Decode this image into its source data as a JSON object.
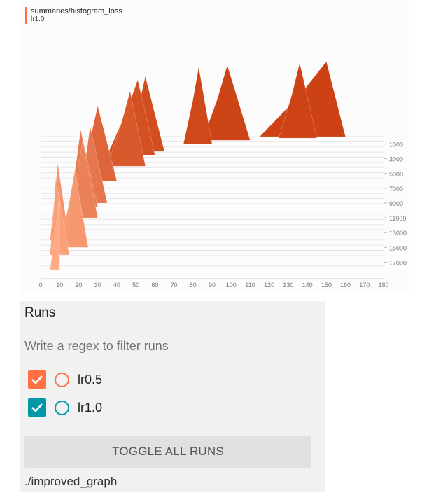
{
  "chart": {
    "tag": "summaries/histogram_loss",
    "run": "lr1.0",
    "y_tick_labels": [
      "1000",
      "3000",
      "5000",
      "7000",
      "9000",
      "11000",
      "13000",
      "15000",
      "17000"
    ],
    "x_tick_labels": [
      "0",
      "10",
      "20",
      "30",
      "40",
      "50",
      "60",
      "70",
      "80",
      "90",
      "100",
      "110",
      "120",
      "130",
      "140",
      "150",
      "160",
      "170",
      "180"
    ]
  },
  "chart_data": {
    "type": "area",
    "title": "summaries/histogram_loss",
    "run": "lr1.0",
    "mode": "offset",
    "xlim": [
      0,
      180
    ],
    "step_ticks": [
      1000,
      3000,
      5000,
      7000,
      9000,
      11000,
      13000,
      15000,
      17000
    ],
    "x_ticks": [
      0,
      10,
      20,
      30,
      40,
      50,
      60,
      70,
      80,
      90,
      100,
      110,
      120,
      130,
      140,
      150,
      160,
      170,
      180
    ],
    "slices_approx": [
      {
        "step": 18000,
        "x": [
          5,
          10
        ],
        "peak": 10
      },
      {
        "step": 16000,
        "x": [
          5,
          15
        ],
        "peak": 8
      },
      {
        "step": 15000,
        "x": [
          10,
          25
        ],
        "peak": 18
      },
      {
        "step": 14000,
        "x": [
          5,
          15
        ],
        "peak": 9
      },
      {
        "step": 11000,
        "x": [
          15,
          30
        ],
        "peak": 22
      },
      {
        "step": 9500,
        "x": [
          15,
          30
        ],
        "peak": 21
      },
      {
        "step": 9000,
        "x": [
          20,
          35
        ],
        "peak": 26
      },
      {
        "step": 6000,
        "x": [
          20,
          40
        ],
        "peak": 30
      },
      {
        "step": 4000,
        "x": [
          35,
          55
        ],
        "peak": 47
      },
      {
        "step": 2500,
        "x": [
          35,
          60
        ],
        "peak": 51
      },
      {
        "step": 2000,
        "x": [
          45,
          65
        ],
        "peak": 55
      },
      {
        "step": 1000,
        "x": [
          75,
          90
        ],
        "peak": 83
      },
      {
        "step": 500,
        "x": [
          85,
          110
        ],
        "peak": 98
      },
      {
        "step": 200,
        "x": [
          125,
          145
        ],
        "peak": 136
      },
      {
        "step": 0,
        "x": [
          115,
          160
        ],
        "peak": 150
      }
    ]
  },
  "runs": {
    "title": "Runs",
    "filter_placeholder": "Write a regex to filter runs",
    "items": [
      {
        "label": "lr0.5",
        "color": "#ff7043",
        "checked": true
      },
      {
        "label": "lr1.0",
        "color": "#0097a7",
        "checked": true
      }
    ],
    "toggle_label": "TOGGLE ALL RUNS",
    "log_dir": "./improved_graph"
  }
}
